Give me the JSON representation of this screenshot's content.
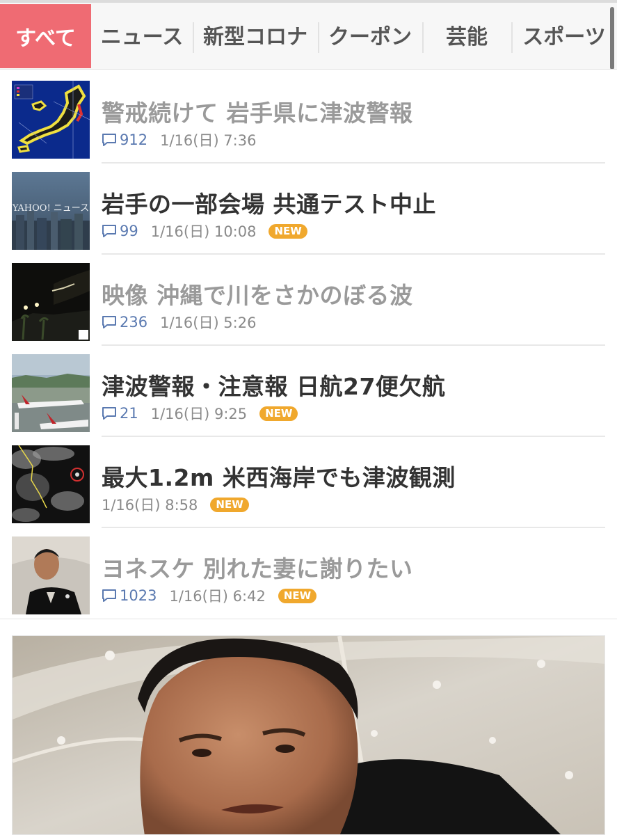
{
  "tabs": [
    {
      "label": "すべて",
      "active": true
    },
    {
      "label": "ニュース"
    },
    {
      "label": "新型コロナ"
    },
    {
      "label": "クーポン"
    },
    {
      "label": "芸能"
    },
    {
      "label": "スポーツ"
    }
  ],
  "news": [
    {
      "title": "警戒続けて 岩手県に津波警報",
      "comments": "912",
      "date": "1/16(日) 7:36",
      "badge": "",
      "read": true
    },
    {
      "title": "岩手の一部会場 共通テスト中止",
      "comments": "99",
      "date": "1/16(日) 10:08",
      "badge": "NEW",
      "read": false,
      "thumb_text": "YAHOO! ニュース"
    },
    {
      "title": "映像 沖縄で川をさかのぼる波",
      "comments": "236",
      "date": "1/16(日) 5:26",
      "badge": "",
      "read": true
    },
    {
      "title": "津波警報・注意報 日航27便欠航",
      "comments": "21",
      "date": "1/16(日) 9:25",
      "badge": "NEW",
      "read": false
    },
    {
      "title": "最大1.2m 米西海岸でも津波観測",
      "comments": "",
      "date": "1/16(日) 8:58",
      "badge": "NEW",
      "read": false
    },
    {
      "title": "ヨネスケ 別れた妻に謝りたい",
      "comments": "1023",
      "date": "1/16(日) 6:42",
      "badge": "NEW",
      "read": true
    }
  ],
  "colors": {
    "accent": "#ef6b73",
    "new_badge": "#f0a82d",
    "comment": "#5a79b0",
    "read_title": "#9a9a9a",
    "unread_title": "#333333"
  }
}
